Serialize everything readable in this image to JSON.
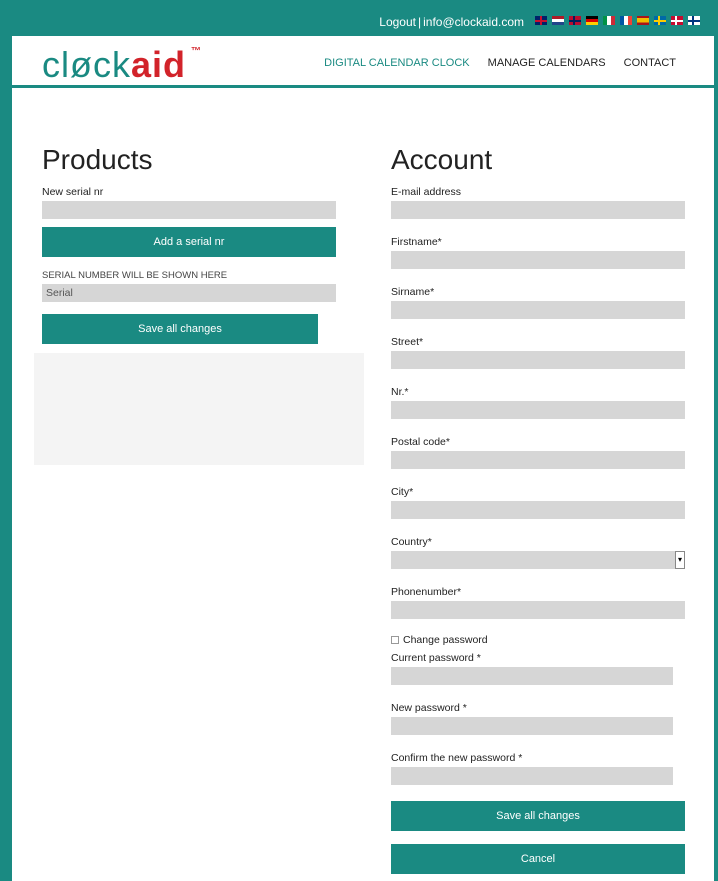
{
  "topbar": {
    "logout": "Logout",
    "email": "info@clockaid.com",
    "flags": [
      "uk",
      "nl",
      "no",
      "de",
      "it",
      "fr",
      "es",
      "se",
      "dk",
      "fi"
    ]
  },
  "logo": {
    "clock": "cløck",
    "aid": "aid",
    "tm": "™"
  },
  "nav": {
    "items": [
      "DIGITAL CALENDAR CLOCK",
      "MANAGE CALENDARS",
      "CONTACT"
    ]
  },
  "products": {
    "title": "Products",
    "serial_label": "New serial nr",
    "add_button": "Add a serial nr",
    "serial_hint": "SERIAL NUMBER WILL BE SHOWN HERE",
    "serial_value": "Serial",
    "save_button": "Save all changes"
  },
  "account": {
    "title": "Account",
    "fields": {
      "email": "E-mail address",
      "firstname": "Firstname*",
      "sirname": "Sirname*",
      "street": "Street*",
      "nr": "Nr.*",
      "postal": "Postal code*",
      "city": "City*",
      "country": "Country*",
      "phone": "Phonenumber*"
    },
    "change_password": "Change password",
    "current_password": "Current password *",
    "new_password": "New password *",
    "confirm_password": "Confirm the new password *",
    "save_button": "Save all changes",
    "cancel_button": "Cancel"
  },
  "colors": {
    "accent": "#1a8a82",
    "logo_red": "#d2232a",
    "field": "#d6d6d6"
  }
}
